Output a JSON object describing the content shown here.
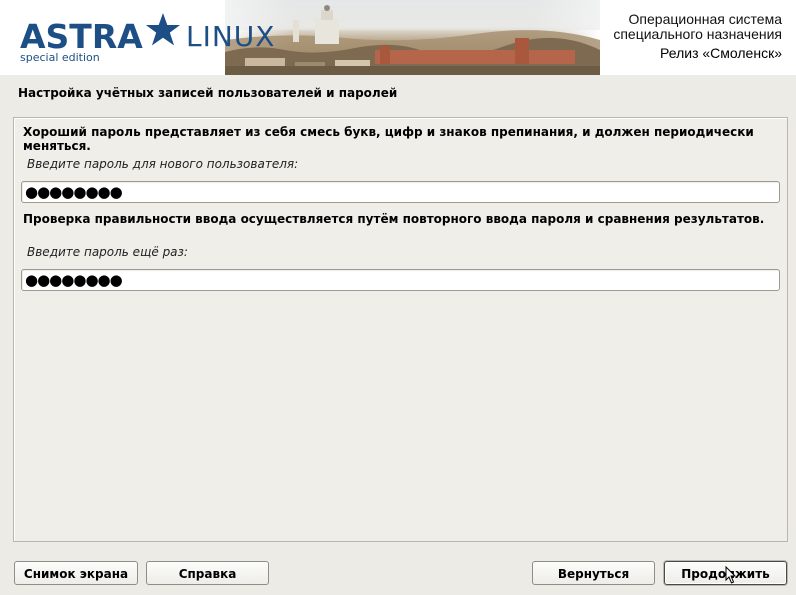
{
  "header": {
    "logo_brand": "ASTRA",
    "logo_product": "LINUX",
    "logo_edition": "special edition",
    "os_line1": "Операционная система",
    "os_line2": "специального назначения",
    "release": "Релиз «Смоленск»",
    "brand_color": "#1d4f86",
    "logo_icon": "star-icon"
  },
  "dialog": {
    "title": "Настройка учётных записей пользователей и паролей",
    "description": "Хороший пароль представляет из себя смесь букв, цифр и знаков препинания, и должен периодически меняться.",
    "password_prompt": "Введите пароль для нового пользователя:",
    "password_value": "●●●●●●●●",
    "verify_description": "Проверка правильности ввода осуществляется путём повторного ввода пароля и сравнения результатов.",
    "verify_prompt": "Введите пароль ещё раз:",
    "verify_value": "●●●●●●●●"
  },
  "buttons": {
    "screenshot": "Снимок экрана",
    "help": "Справка",
    "back": "Вернуться",
    "continue": "Продолжить"
  }
}
